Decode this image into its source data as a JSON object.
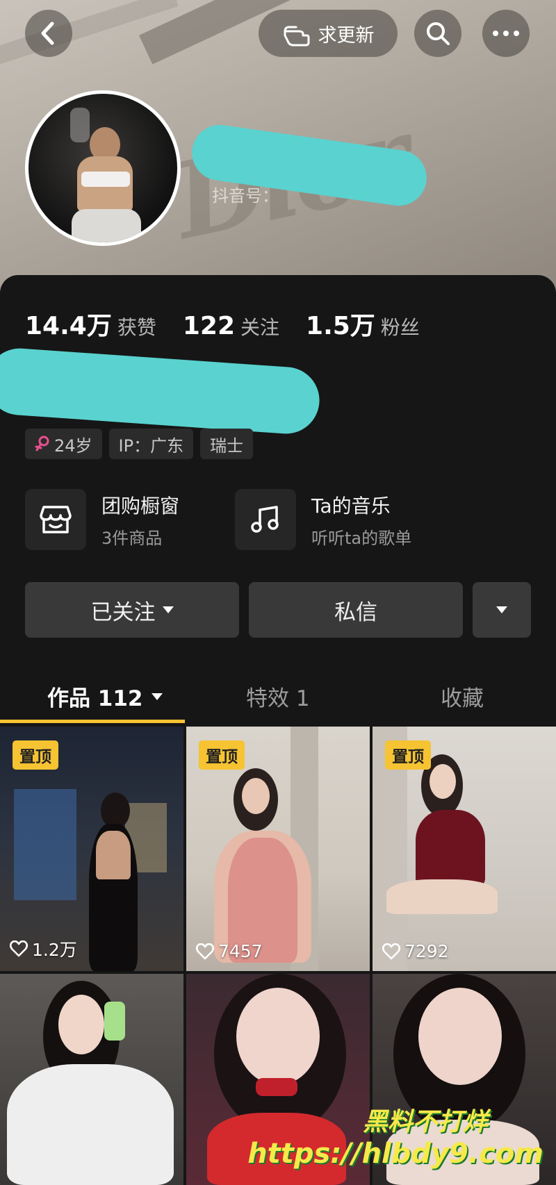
{
  "header": {
    "request_update_label": "求更新",
    "handle_prefix": "抖音号："
  },
  "stats": [
    {
      "value": "14.4万",
      "label": "获赞"
    },
    {
      "value": "122",
      "label": "关注"
    },
    {
      "value": "1.5万",
      "label": "粉丝"
    }
  ],
  "tags": {
    "age": "24岁",
    "ip": "IP：广东",
    "location": "瑞士"
  },
  "features": {
    "shop": {
      "title": "团购橱窗",
      "subtitle": "3件商品"
    },
    "music": {
      "title": "Ta的音乐",
      "subtitle": "听听ta的歌单"
    }
  },
  "actions": {
    "following_label": "已关注",
    "message_label": "私信"
  },
  "tabs": {
    "works_label": "作品 112",
    "effects_label": "特效 1",
    "favorites_label": "收藏"
  },
  "grid": {
    "pinned_label": "置顶",
    "items": [
      {
        "likes": "1.2万"
      },
      {
        "likes": "7457"
      },
      {
        "likes": "7292"
      }
    ]
  },
  "watermark": {
    "line1": "黑料不打烊",
    "line2": "https://hlbdy9.com"
  },
  "colors": {
    "accent_yellow": "#f6c332",
    "redaction": "#5ad2cf",
    "background": "#161616"
  }
}
